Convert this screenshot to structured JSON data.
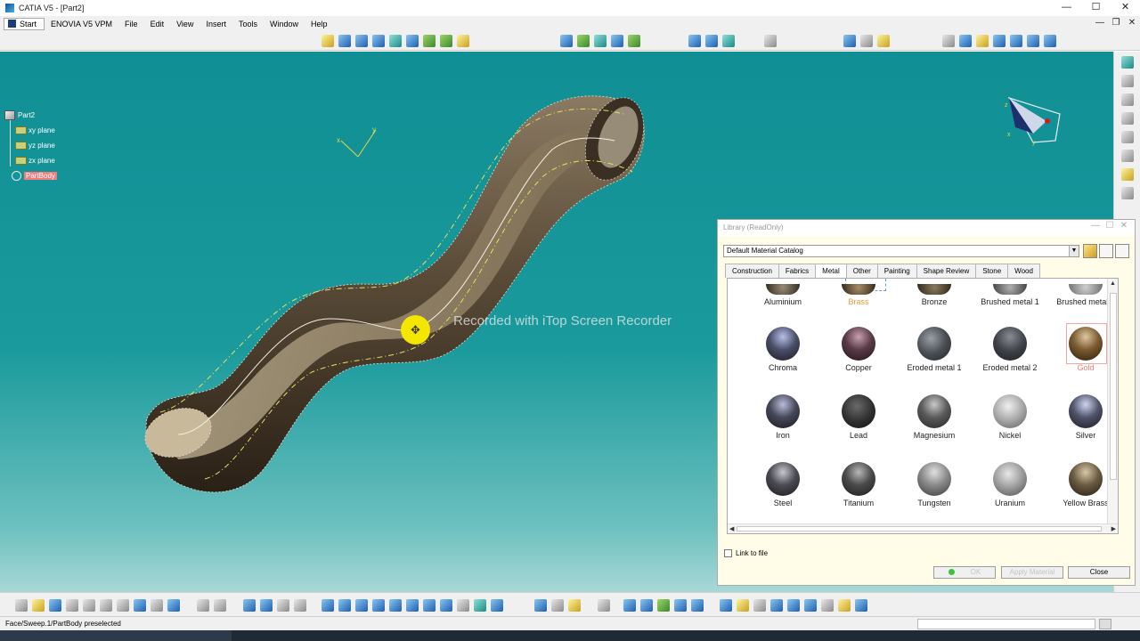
{
  "window": {
    "title": "CATIA V5 - [Part2]",
    "minimize": "—",
    "maximize": "☐",
    "close": "✕"
  },
  "menu": {
    "start": "Start",
    "items": [
      "ENOVIA V5 VPM",
      "File",
      "Edit",
      "View",
      "Insert",
      "Tools",
      "Window",
      "Help"
    ],
    "doc_controls": [
      "—",
      "❐",
      "✕"
    ]
  },
  "tree": {
    "root": "Part2",
    "planes": [
      "xy plane",
      "yz plane",
      "zx plane"
    ],
    "body": "PartBody"
  },
  "compass_labels": {
    "x": "x",
    "y": "y",
    "z": "z"
  },
  "axis_labels": {
    "x": "x",
    "y": "y"
  },
  "watermark": "Recorded with iTop Screen Recorder",
  "cursor_symbol": "✥",
  "status": {
    "message": "Face/Sweep.1/PartBody preselected"
  },
  "library": {
    "title": "Library (ReadOnly)",
    "title_controls": [
      "—",
      "☐",
      "✕"
    ],
    "catalog": "Default Material Catalog",
    "catalog_arrow": "▼",
    "tabs": [
      "Construction",
      "Fabrics",
      "Metal",
      "Other",
      "Painting",
      "Shape Review",
      "Stone",
      "Wood"
    ],
    "active_tab": "Metal",
    "materials": {
      "row1": [
        "Aluminium",
        "Brass",
        "Bronze",
        "Brushed metal 1",
        "Brushed metal 2"
      ],
      "row2": [
        "Chroma",
        "Copper",
        "Eroded metal 1",
        "Eroded metal 2",
        "Gold"
      ],
      "row3": [
        "Iron",
        "Lead",
        "Magnesium",
        "Nickel",
        "Silver"
      ],
      "row4": [
        "Steel",
        "Titanium",
        "Tungsten",
        "Uranium",
        "Yellow Brass"
      ]
    },
    "highlighted": [
      "Brass",
      "Gold"
    ],
    "link_to_file": "Link to file",
    "buttons": {
      "ok": "OK",
      "apply": "Apply Material",
      "close": "Close"
    },
    "scroll_arrows": {
      "up": "▲",
      "down": "▼",
      "left": "◀",
      "right": "▶"
    }
  },
  "colors": {
    "viewport_bg": "#108f94",
    "sweep_surface": "#4a3f30",
    "highlight_material": "#e59b3a",
    "gold_label": "#e8807f",
    "partbody_highlight": "#f07d7d"
  }
}
